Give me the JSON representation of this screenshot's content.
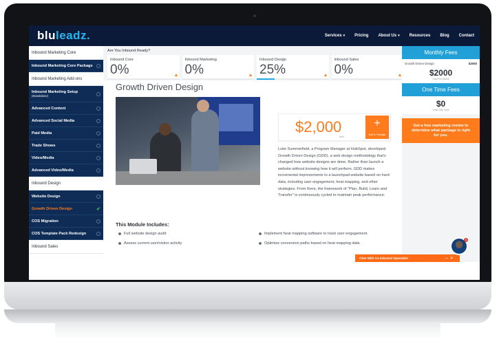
{
  "nav": {
    "logo": {
      "main": "blu",
      "accent": "leadz."
    },
    "items": [
      {
        "label": "Services",
        "dropdown": true
      },
      {
        "label": "Pricing",
        "dropdown": false
      },
      {
        "label": "About Us",
        "dropdown": true
      },
      {
        "label": "Resources",
        "dropdown": false
      },
      {
        "label": "Blog",
        "dropdown": false
      },
      {
        "label": "Contact",
        "dropdown": false
      }
    ]
  },
  "sidebar": {
    "sections": [
      {
        "title": "Inbound Marketing Core",
        "items": [
          {
            "label": "Inbound Marketing Core Package",
            "sub": "",
            "state": "default"
          }
        ]
      },
      {
        "title": "Inbound Marketing Add-ons",
        "items": [
          {
            "label": "Inbound Marketing Setup",
            "sub": "(Standalone)",
            "state": "default"
          },
          {
            "label": "Advanced Content",
            "sub": "",
            "state": "default"
          },
          {
            "label": "Advanced Social Media",
            "sub": "",
            "state": "default"
          },
          {
            "label": "Paid Media",
            "sub": "",
            "state": "default"
          },
          {
            "label": "Trade Shows",
            "sub": "",
            "state": "default"
          },
          {
            "label": "Video/Media",
            "sub": "",
            "state": "default"
          },
          {
            "label": "Advanced Video/Media",
            "sub": "",
            "state": "default"
          }
        ]
      },
      {
        "title": "Inbound Design",
        "items": [
          {
            "label": "Website Design",
            "sub": "",
            "state": "default"
          },
          {
            "label": "Growth Driven Design",
            "sub": "",
            "state": "active"
          },
          {
            "label": "COS Migration",
            "sub": "",
            "state": "default"
          },
          {
            "label": "COS Template Pack Redesign",
            "sub": "",
            "state": "default"
          }
        ]
      },
      {
        "title": "Inbound Sales",
        "items": []
      }
    ]
  },
  "main": {
    "ready_label": "Are You Inbound Ready?",
    "cards": [
      {
        "label": "Inbound Core",
        "value": "0%",
        "progress": 0
      },
      {
        "label": "Inbound Marketing",
        "value": "0%",
        "progress": 0
      },
      {
        "label": "Inbound Design",
        "value": "25%",
        "progress": 0.25
      },
      {
        "label": "Inbound Sales",
        "value": "0%",
        "progress": 0
      }
    ],
    "module": {
      "title": "Growth Driven Design",
      "price": "$2,000",
      "price_unit": "/mo",
      "add_label": "Add To Package",
      "add_symbol": "+",
      "description": "Luke Summerfield, a Program Manager at HubSpot, developed Growth Driven Design (GDD), a web design methodology that's changed how website designs are done. Rather than launch a website without knowing how it will perform, GDD makes incremental improvements to a launchpad website based on hard data, including user engagement, heat mapping, and other strategies. From there, the framework of \"Plan, Build, Learn and Transfer\" is continuously cycled to maintain peak performance.",
      "includes_title": "This Module Includes:",
      "includes": [
        "Full website design audit",
        "Implement heat mapping software to track user engagement",
        "Assess current user/visitor activity",
        "Optimize conversion paths based on heat mapping data"
      ]
    }
  },
  "fees": {
    "monthly_title": "Monthly Fees",
    "monthly_line_label": "Growth Driven Design",
    "monthly_line_amount": "$2000",
    "monthly_total": "$2000",
    "monthly_total_label": "Total Per Month",
    "one_time_title": "One Time Fees",
    "one_time_total": "$0",
    "one_time_total_label": "Total One Time",
    "cta": "Get a free marketing review to determine what package is right for you."
  },
  "chat": {
    "label": "Chat With An Inbound Specialist",
    "minimize": "–",
    "close": "×",
    "badge": "1"
  },
  "colors": {
    "nav_bg": "#0c1a3a",
    "sidebar_item_bg": "#0e2c55",
    "accent_orange": "#ff7b1c",
    "accent_blue": "#21a0d8",
    "check_green": "#36c15a"
  }
}
